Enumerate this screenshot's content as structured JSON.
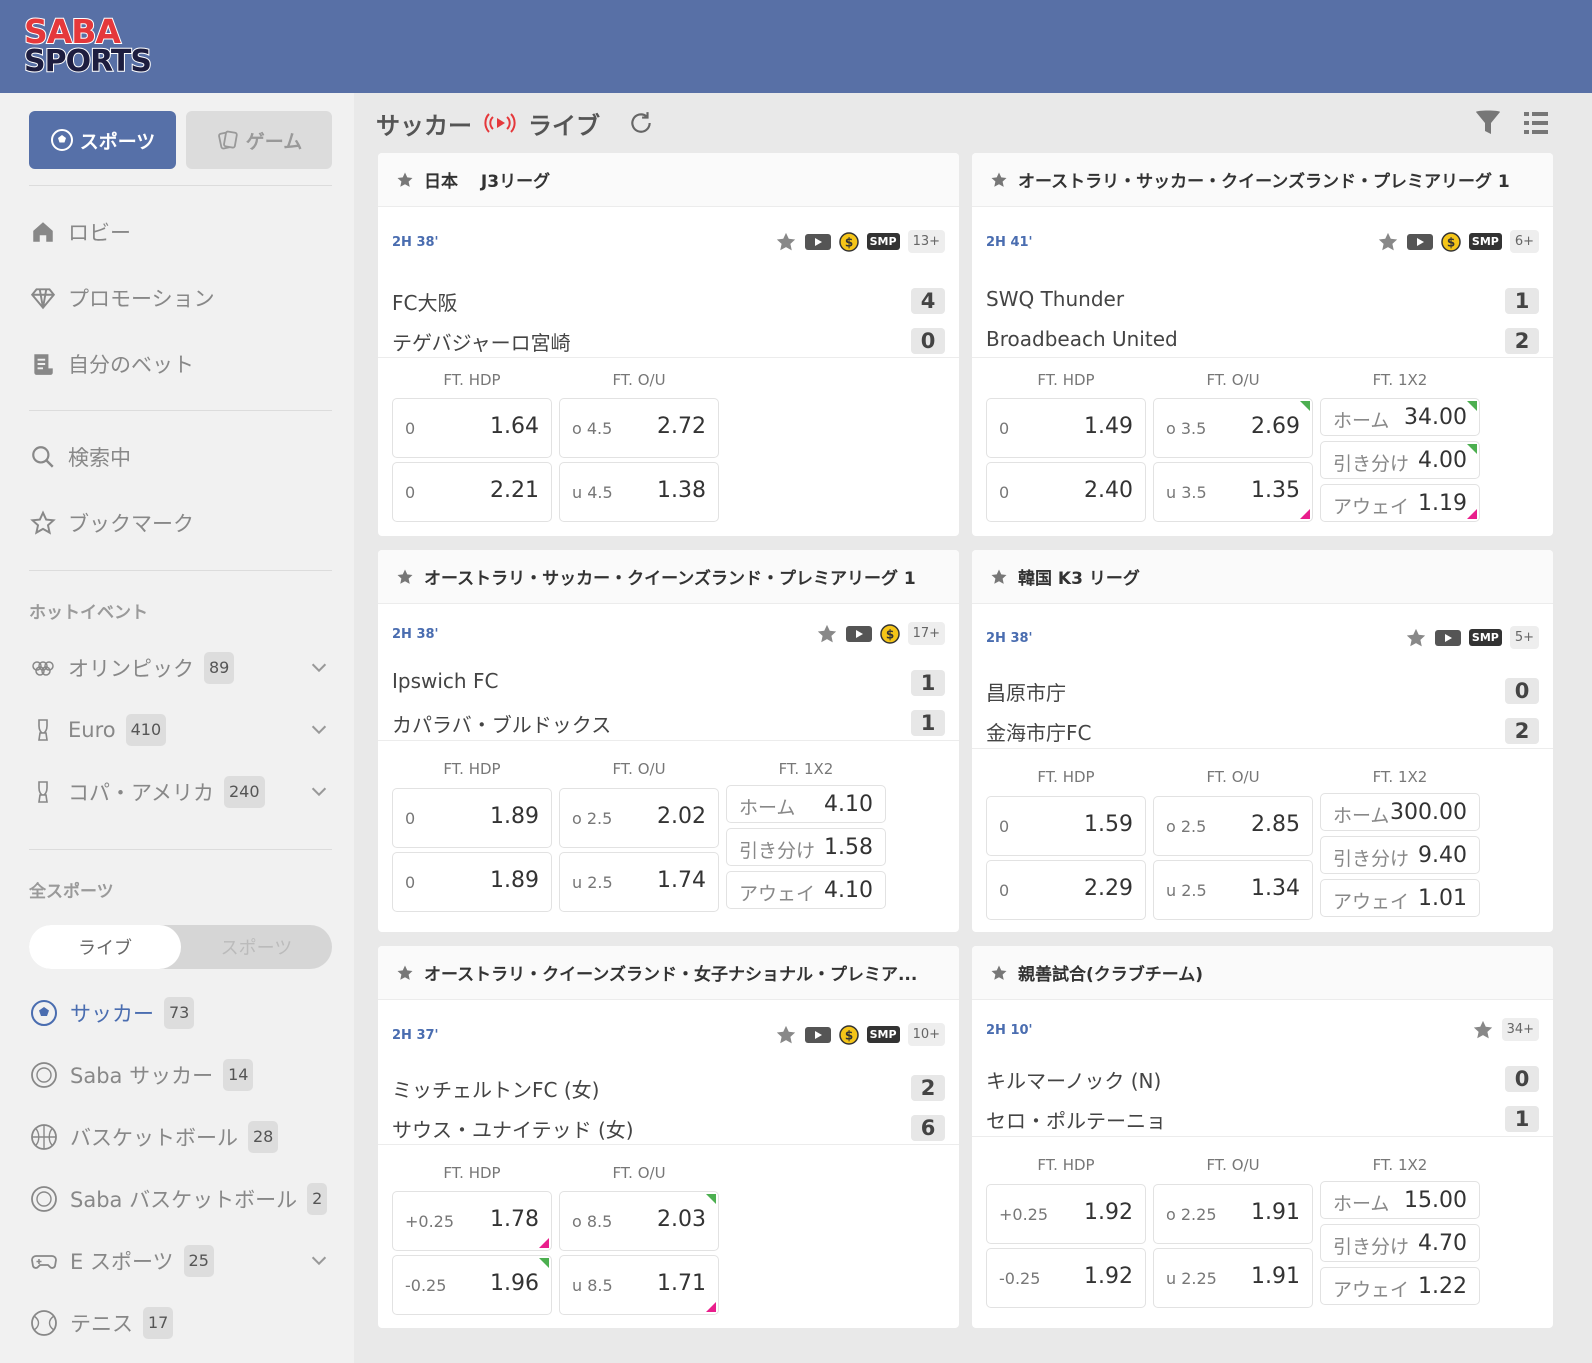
{
  "brand": {
    "logo_line1": "SABA",
    "logo_line2": "SPORTS"
  },
  "mode_buttons": {
    "sports": "スポーツ",
    "game": "ゲーム"
  },
  "nav": {
    "lobby": "ロビー",
    "promotion": "プロモーション",
    "my_bets": "自分のベット",
    "search": "検索中",
    "bookmark": "ブックマーク"
  },
  "hot_events": {
    "title": "ホットイベント",
    "items": [
      {
        "label": "オリンピック",
        "count": "89"
      },
      {
        "label": "Euro",
        "count": "410"
      },
      {
        "label": "コパ・アメリカ",
        "count": "240"
      }
    ]
  },
  "all_sports": {
    "title": "全スポーツ",
    "toggle_live": "ライブ",
    "toggle_sports": "スポーツ",
    "items": [
      {
        "label": "サッカー",
        "count": "73"
      },
      {
        "label": "Saba サッカー",
        "count": "14"
      },
      {
        "label": "バスケットボール",
        "count": "28"
      },
      {
        "label": "Saba バスケットボール",
        "count": "2"
      },
      {
        "label": "E スポーツ",
        "count": "25"
      },
      {
        "label": "テニス",
        "count": "17"
      }
    ]
  },
  "main_header": {
    "sport": "サッカー",
    "live": "ライブ"
  },
  "colors": {
    "topbar": "#5870a6",
    "accent": "#4a6db0",
    "odds_up": "#4caf50",
    "odds_down": "#e91e8c"
  },
  "matches": [
    {
      "league": "日本　 J3リーグ",
      "time": "2H 38'",
      "more": "13+",
      "home": "FC大阪",
      "away": "テゲバジャーロ宮崎",
      "home_score": "4",
      "away_score": "0",
      "mkt_hdp": "FT. HDP",
      "mkt_ou": "FT. O/U",
      "hdp": [
        {
          "line": "0",
          "odds": "1.64"
        },
        {
          "line": "0",
          "odds": "2.21"
        }
      ],
      "ou": [
        {
          "line": "o 4.5",
          "odds": "2.72"
        },
        {
          "line": "u 4.5",
          "odds": "1.38"
        }
      ]
    },
    {
      "league": "オーストラリ・サッカー・クイーンズランド・プレミアリーグ 1",
      "time": "2H 41'",
      "more": "6+",
      "home": "SWQ Thunder",
      "away": "Broadbeach United",
      "home_score": "1",
      "away_score": "2",
      "mkt_hdp": "FT. HDP",
      "mkt_ou": "FT. O/U",
      "mkt_1x2": "FT. 1X2",
      "hdp": [
        {
          "line": "0",
          "odds": "1.49"
        },
        {
          "line": "0",
          "odds": "2.40"
        }
      ],
      "ou": [
        {
          "line": "o 3.5",
          "odds": "2.69"
        },
        {
          "line": "u 3.5",
          "odds": "1.35"
        }
      ],
      "x12": [
        {
          "label": "ホーム",
          "odds": "34.00"
        },
        {
          "label": "引き分け",
          "odds": "4.00"
        },
        {
          "label": "アウェイ",
          "odds": "1.19"
        }
      ]
    },
    {
      "league": "オーストラリ・サッカー・クイーンズランド・プレミアリーグ 1",
      "time": "2H 38'",
      "more": "17+",
      "home": "Ipswich FC",
      "away": "カパラバ・ブルドックス",
      "home_score": "1",
      "away_score": "1",
      "mkt_hdp": "FT. HDP",
      "mkt_ou": "FT. O/U",
      "mkt_1x2": "FT. 1X2",
      "hdp": [
        {
          "line": "0",
          "odds": "1.89"
        },
        {
          "line": "0",
          "odds": "1.89"
        }
      ],
      "ou": [
        {
          "line": "o 2.5",
          "odds": "2.02"
        },
        {
          "line": "u 2.5",
          "odds": "1.74"
        }
      ],
      "x12": [
        {
          "label": "ホーム",
          "odds": "4.10"
        },
        {
          "label": "引き分け",
          "odds": "1.58"
        },
        {
          "label": "アウェイ",
          "odds": "4.10"
        }
      ]
    },
    {
      "league": "韓国 K3 リーグ",
      "time": "2H 38'",
      "more": "5+",
      "home": "昌原市庁",
      "away": "金海市庁FC",
      "home_score": "0",
      "away_score": "2",
      "mkt_hdp": "FT. HDP",
      "mkt_ou": "FT. O/U",
      "mkt_1x2": "FT. 1X2",
      "hdp": [
        {
          "line": "0",
          "odds": "1.59"
        },
        {
          "line": "0",
          "odds": "2.29"
        }
      ],
      "ou": [
        {
          "line": "o 2.5",
          "odds": "2.85"
        },
        {
          "line": "u 2.5",
          "odds": "1.34"
        }
      ],
      "x12": [
        {
          "label": "ホーム",
          "odds": "300.00"
        },
        {
          "label": "引き分け",
          "odds": "9.40"
        },
        {
          "label": "アウェイ",
          "odds": "1.01"
        }
      ]
    },
    {
      "league": "オーストラリ・クイーンズランド・女子ナショナル・プレミア...",
      "time": "2H 37'",
      "more": "10+",
      "home": "ミッチェルトンFC (女)",
      "away": "サウス・ユナイテッド (女)",
      "home_score": "2",
      "away_score": "6",
      "mkt_hdp": "FT. HDP",
      "mkt_ou": "FT. O/U",
      "hdp": [
        {
          "line": "+0.25",
          "odds": "1.78"
        },
        {
          "line": "-0.25",
          "odds": "1.96"
        }
      ],
      "ou": [
        {
          "line": "o 8.5",
          "odds": "2.03"
        },
        {
          "line": "u 8.5",
          "odds": "1.71"
        }
      ]
    },
    {
      "league": "親善試合(クラブチーム)",
      "time": "2H 10'",
      "more": "34+",
      "home": "キルマーノック (N)",
      "away": "セロ・ポルテーニョ",
      "home_score": "0",
      "away_score": "1",
      "mkt_hdp": "FT. HDP",
      "mkt_ou": "FT. O/U",
      "mkt_1x2": "FT. 1X2",
      "hdp": [
        {
          "line": "+0.25",
          "odds": "1.92"
        },
        {
          "line": "-0.25",
          "odds": "1.92"
        }
      ],
      "ou": [
        {
          "line": "o 2.25",
          "odds": "1.91"
        },
        {
          "line": "u 2.25",
          "odds": "1.91"
        }
      ],
      "x12": [
        {
          "label": "ホーム",
          "odds": "15.00"
        },
        {
          "label": "引き分け",
          "odds": "4.70"
        },
        {
          "label": "アウェイ",
          "odds": "1.22"
        }
      ]
    }
  ]
}
